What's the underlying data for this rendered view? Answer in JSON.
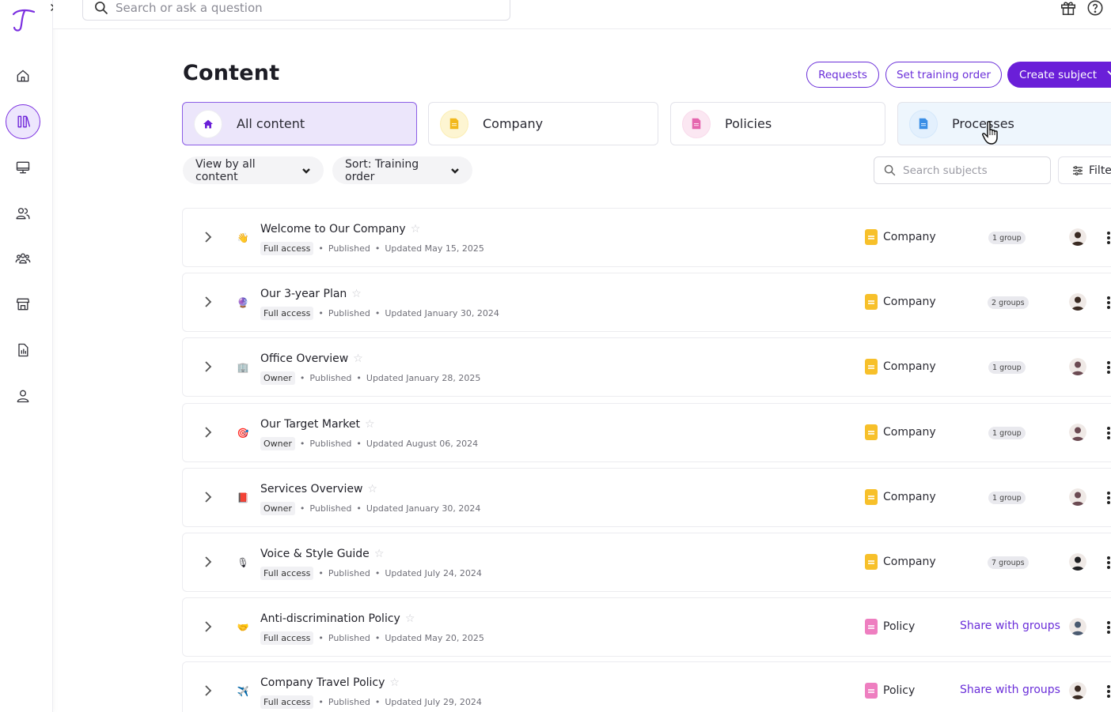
{
  "topbar": {
    "search_placeholder": "Search or ask a question",
    "gift_icon": "gift-icon",
    "help_icon": "help-icon"
  },
  "sidebar": {
    "items": [
      {
        "name": "home",
        "icon": "home-icon"
      },
      {
        "name": "content",
        "icon": "library-icon",
        "active": true
      },
      {
        "name": "training",
        "icon": "monitor-icon"
      },
      {
        "name": "people",
        "icon": "users-icon"
      },
      {
        "name": "groups",
        "icon": "group-icon"
      },
      {
        "name": "marketplace",
        "icon": "store-icon"
      },
      {
        "name": "reports",
        "icon": "report-icon"
      },
      {
        "name": "profile",
        "icon": "person-icon"
      }
    ]
  },
  "header": {
    "title": "Content",
    "requests_label": "Requests",
    "training_order_label": "Set training order",
    "create_subject_label": "Create subject"
  },
  "categories": [
    {
      "label": "All content",
      "icon": "home-icon"
    },
    {
      "label": "Company",
      "icon": "company-doc-icon"
    },
    {
      "label": "Policies",
      "icon": "policy-doc-icon"
    },
    {
      "label": "Processes",
      "icon": "process-doc-icon"
    }
  ],
  "filters": {
    "view_label": "View by all content",
    "sort_label": "Sort: Training order",
    "search_placeholder": "Search subjects",
    "filter_label": "Filter"
  },
  "rows": [
    {
      "emoji": "👋",
      "title": "Welcome to Our Company",
      "access": "Full access",
      "status": "Published",
      "updated": "Updated May 15, 2025",
      "type": "Company",
      "groups": "1 group",
      "avatar_tone": "#3a2a22"
    },
    {
      "emoji": "🔮",
      "title": "Our 3-year Plan",
      "access": "Full access",
      "status": "Published",
      "updated": "Updated January 30, 2024",
      "type": "Company",
      "groups": "2 groups",
      "avatar_tone": "#3a2a22"
    },
    {
      "emoji": "🏢",
      "title": "Office Overview",
      "access": "Owner",
      "status": "Published",
      "updated": "Updated January 28, 2025",
      "type": "Company",
      "groups": "1 group",
      "avatar_tone": "#6b4a52"
    },
    {
      "emoji": "🎯",
      "title": "Our Target Market",
      "access": "Owner",
      "status": "Published",
      "updated": "Updated August 06, 2024",
      "type": "Company",
      "groups": "1 group",
      "avatar_tone": "#6b4a52"
    },
    {
      "emoji": "📕",
      "title": "Services Overview",
      "access": "Owner",
      "status": "Published",
      "updated": "Updated January 30, 2024",
      "type": "Company",
      "groups": "1 group",
      "avatar_tone": "#6b4a52"
    },
    {
      "emoji": "🎙",
      "title": "Voice & Style Guide",
      "access": "Full access",
      "status": "Published",
      "updated": "Updated July 24, 2024",
      "type": "Company",
      "groups": "7 groups",
      "avatar_tone": "#1f1f22"
    },
    {
      "emoji": "🤝",
      "title": "Anti-discrimination Policy",
      "access": "Full access",
      "status": "Published",
      "updated": "Updated May 20, 2025",
      "type": "Policy",
      "share": "Share with groups",
      "avatar_tone": "#4a5a70"
    },
    {
      "emoji": "✈️",
      "title": "Company Travel Policy",
      "access": "Full access",
      "status": "Published",
      "updated": "Updated July 29, 2024",
      "type": "Policy",
      "share": "Share with groups",
      "avatar_tone": "#3a2a22"
    }
  ],
  "colors": {
    "accent": "#6a1fd8",
    "company": "#f7c02a",
    "policy": "#ee7ec0"
  }
}
